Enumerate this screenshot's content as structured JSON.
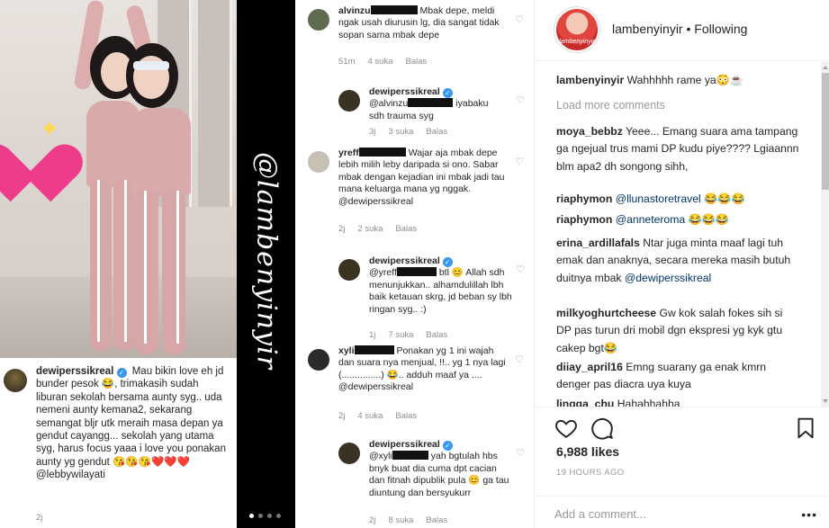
{
  "header": {
    "username": "lambenyinyir",
    "separator": "•",
    "follow_status": "Following",
    "avatar_label": "lambenyinyir"
  },
  "left_caption": {
    "username": "dewiperssikreal",
    "text": "Mau bikin love eh jd bunder pesok 😂, trimakasih sudah liburan sekolah bersama aunty syg.. uda nemeni aunty kemana2, sekarang semangat bljr utk meraih masa depan ya gendut cayangg... sekolah yang utama syg, harus focus yaaa i love you ponakan aunty yg gendut 😘😘😘❤️❤️❤️",
    "mention": "@lebbywilayati",
    "time": "2j"
  },
  "watermark": "@lambenyinyir",
  "carousel": {
    "count": 4,
    "active": 0
  },
  "screenshot_comments": [
    {
      "user": "alvinzu",
      "text": "Mbak depe, meldi ngak usah diurusin lg, dia sangat tidak sopan sama mbak depe",
      "time": "51m",
      "likes": "4 suka",
      "reply": "Balas"
    },
    {
      "user": "dewiperssikreal",
      "mention": "@alvinzu",
      "text": "iyabaku sdh trauma syg",
      "time": "3j",
      "likes": "3 suka",
      "reply": "Balas"
    },
    {
      "user": "yreff",
      "text": "Wajar aja mbak depe lebih milih leby daripada si ono. Sabar mbak dengan kejadian ini mbak jadi tau mana keluarga mana yg nggak.",
      "mention_after": "@dewiperssikreal",
      "time": "2j",
      "likes": "2 suka",
      "reply": "Balas"
    },
    {
      "user": "dewiperssikreal",
      "mention": "@yreff",
      "text": "btl 😊 Allah sdh menunjukkan.. alhamdulillah lbh baik ketauan skrg, jd beban sy lbh ringan syg.. :)",
      "time": "1j",
      "likes": "7 suka",
      "reply": "Balas"
    },
    {
      "user": "xyli",
      "text": "Ponakan yg 1 ini wajah dan suara nya menjual, !!.. yg 1 nya lagi (...............) 😂.. adduh maaf ya ....",
      "mention_after": "@dewiperssikreal",
      "time": "2j",
      "likes": "4 suka",
      "reply": "Balas"
    },
    {
      "user": "dewiperssikreal",
      "mention": "@xyli",
      "text": "yah bgtulah hbs bnyk buat dia cuma dpt cacian dan fitnah dipublik pula 😊 ga tau diuntung dan bersyukurr",
      "time": "2j",
      "likes": "8 suka",
      "reply": "Balas"
    }
  ],
  "comments": [
    {
      "user": "lambenyinyir",
      "text": "Wahhhhh rame ya😳☕"
    },
    {
      "user": "moya_bebbz",
      "text": "Yeee... Emang suara ama tampang ga ngejual trus mami DP kudu piye???? Lgiaannn blm apa2 dh songong sihh,"
    },
    {
      "user": "riaphymon",
      "mention": "@llunastoretravel",
      "text": "😂😂😂"
    },
    {
      "user": "riaphymon",
      "mention": "@anneteroma",
      "text": "😂😂😂"
    },
    {
      "user": "erina_ardillafals",
      "text": "Ntar juga minta maaf lagi tuh emak dan anaknya, secara mereka masih butuh duitnya mbak",
      "mention_after": "@dewiperssikreal"
    },
    {
      "user": "milkyoghurtcheese",
      "text": "Gw kok salah fokes sih si DP pas turun dri mobil dgn ekspresi yg kyk gtu cakep bgt😂"
    },
    {
      "user": "diiay_april16",
      "text": "Emng suarany ga enak kmrn denger pas diacra uya kuya"
    },
    {
      "user": "lingga_chu",
      "text": "Hahahhahha"
    }
  ],
  "load_more": "Load more comments",
  "likes": "6,988 likes",
  "time_ago": "19 HOURS AGO",
  "add_comment_placeholder": "Add a comment...",
  "more_options": "•••",
  "colors": {
    "link": "#003569",
    "verified": "#3897f0",
    "muted": "#999999",
    "strip": "#000000"
  }
}
